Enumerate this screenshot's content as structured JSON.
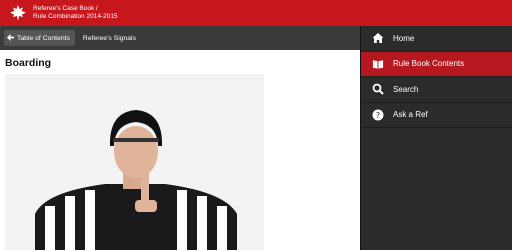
{
  "header": {
    "title_line1": "Referee's Case Book /",
    "title_line2": "Rule Combination 2014-2015",
    "logo_icon": "hockey-canada-logo"
  },
  "subbar": {
    "back_label": "Table of Contents",
    "breadcrumb": "Referee's Signals"
  },
  "main": {
    "title": "Boarding",
    "image_icon": "referee-signal-photo"
  },
  "drawer": {
    "items": [
      {
        "label": "Home",
        "icon": "home-icon"
      },
      {
        "label": "Rule Book Contents",
        "icon": "book-icon",
        "active": true
      },
      {
        "label": "Search",
        "icon": "search-icon"
      },
      {
        "label": "Ask a Ref",
        "icon": "help-icon"
      }
    ]
  },
  "colors": {
    "brand_red": "#c8161d",
    "active_red": "#b5181f",
    "drawer_bg": "#2b2b2b",
    "subbar_bg": "#3a3a3a"
  }
}
